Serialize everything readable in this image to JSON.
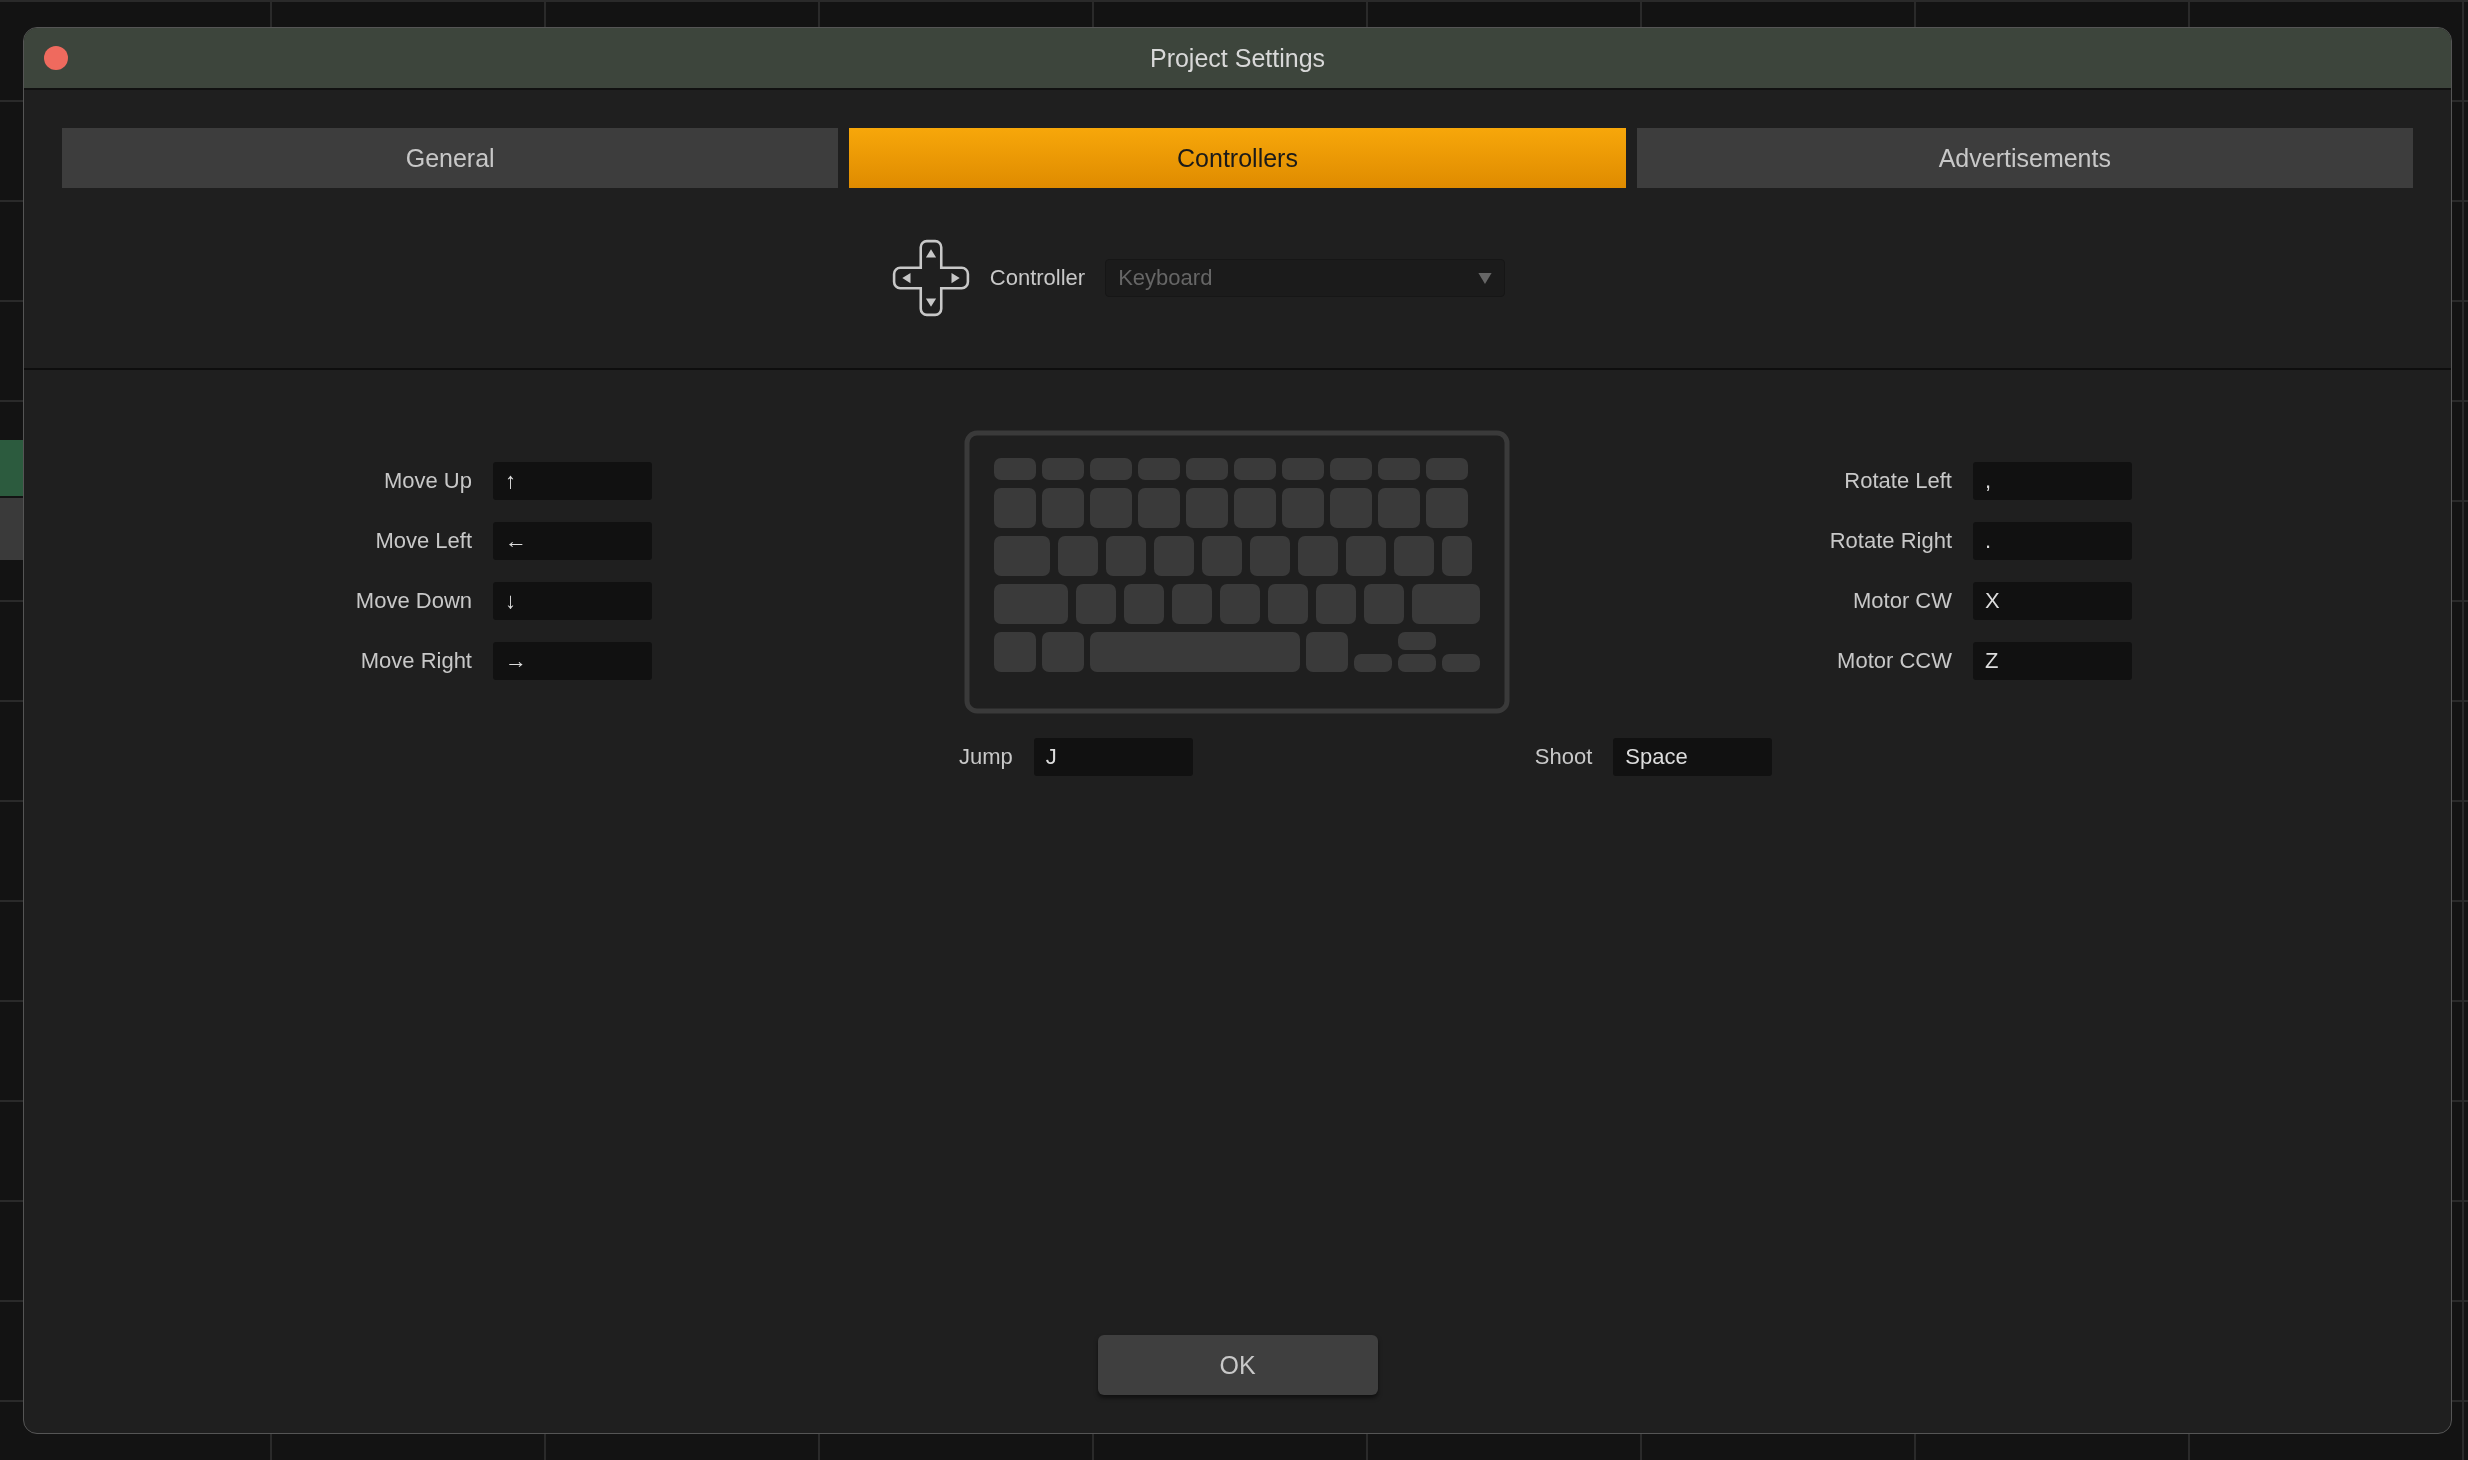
{
  "window": {
    "title": "Project Settings"
  },
  "tabs": [
    {
      "label": "General",
      "selected": false
    },
    {
      "label": "Controllers",
      "selected": true
    },
    {
      "label": "Advertisements",
      "selected": false
    }
  ],
  "controller": {
    "label": "Controller",
    "value": "Keyboard",
    "disabled": true
  },
  "left_bindings": [
    {
      "label": "Move Up",
      "key": "↑"
    },
    {
      "label": "Move Left",
      "key": "←"
    },
    {
      "label": "Move Down",
      "key": "↓"
    },
    {
      "label": "Move Right",
      "key": "→"
    }
  ],
  "right_bindings": [
    {
      "label": "Rotate Left",
      "key": ","
    },
    {
      "label": "Rotate Right",
      "key": "."
    },
    {
      "label": "Motor CW",
      "key": "X"
    },
    {
      "label": "Motor CCW",
      "key": "Z"
    }
  ],
  "bottom_bindings": [
    {
      "label": "Jump",
      "key": "J"
    },
    {
      "label": "Shoot",
      "key": "Space"
    }
  ],
  "buttons": [
    "OK"
  ]
}
